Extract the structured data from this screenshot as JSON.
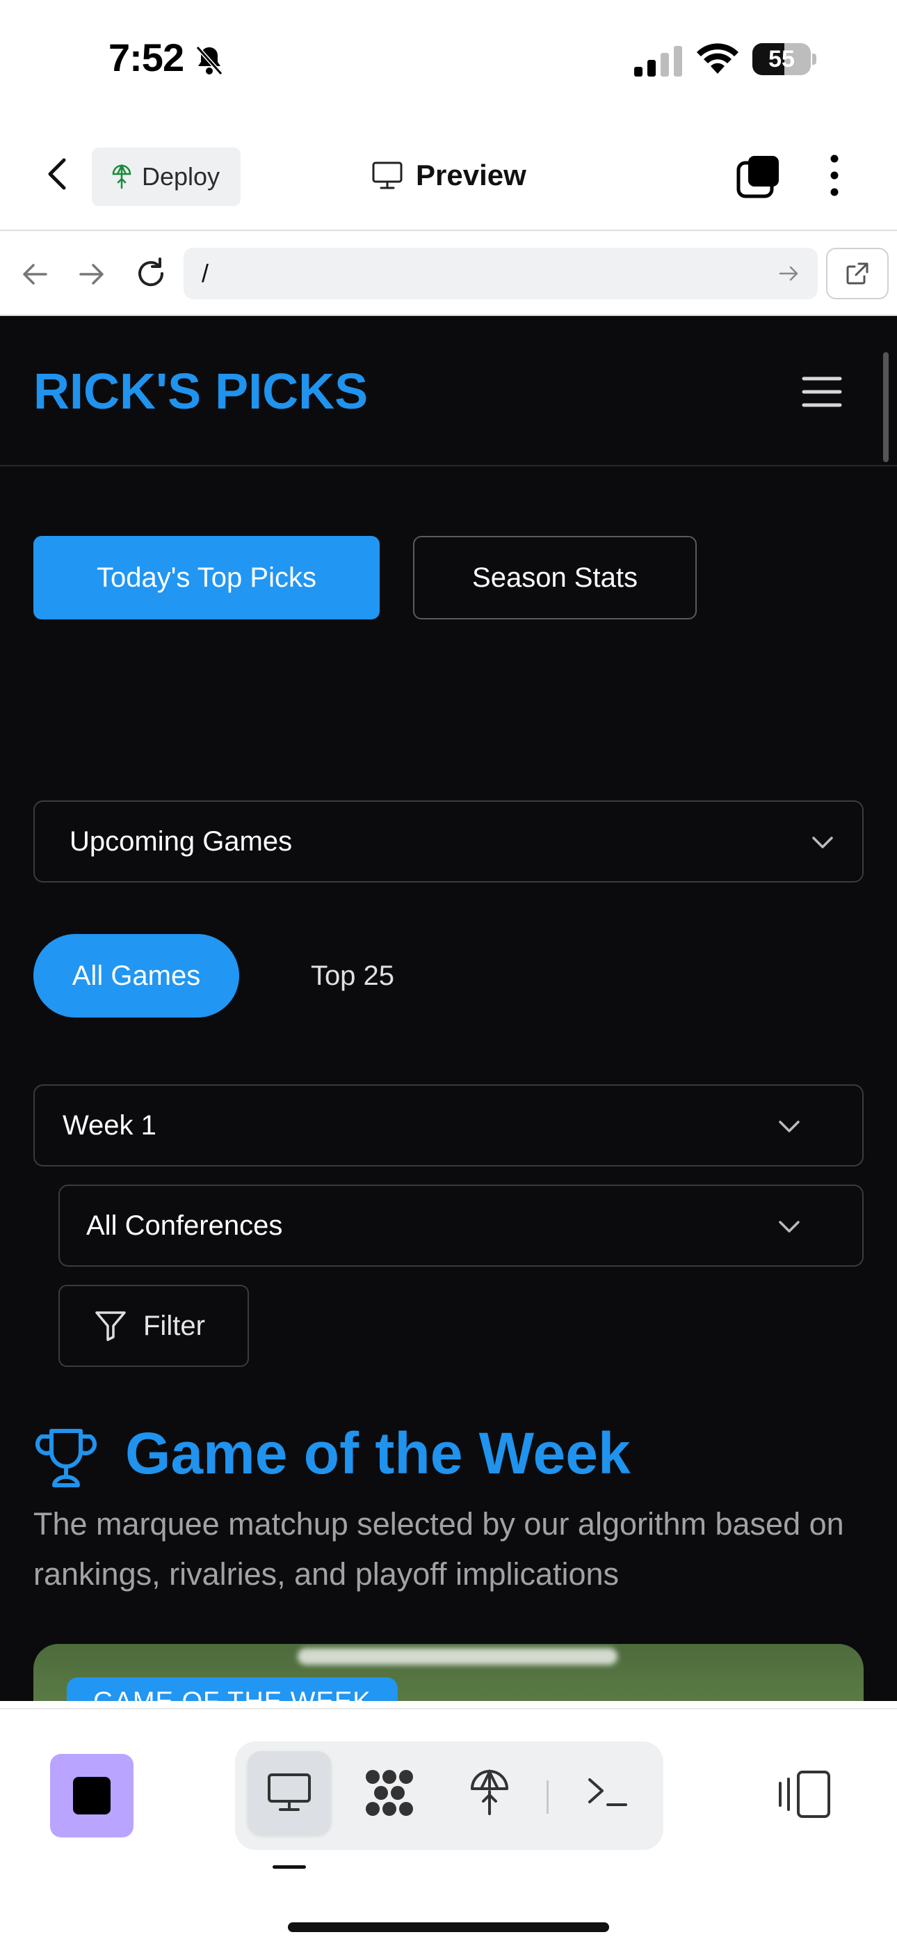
{
  "status_bar": {
    "time": "7:52",
    "battery_level": "55",
    "battery_fraction": 0.55
  },
  "app_header": {
    "deploy_label": "Deploy",
    "title": "Preview"
  },
  "url_bar": {
    "value": "/"
  },
  "site": {
    "logo": "RICK'S PICKS",
    "buttons": {
      "top_picks": "Today's Top Picks",
      "season_stats": "Season Stats"
    },
    "games_select": "Upcoming Games",
    "pills": {
      "all_games": "All Games",
      "top25": "Top 25"
    },
    "week_select": "Week 1",
    "conference_select": "All Conferences",
    "filter_label": "Filter",
    "gotw": {
      "title": "Game of the Week",
      "subtitle": "The marquee matchup selected by our algorithm based on rankings, rivalries, and playoff implications",
      "badge": "GAME OF THE WEEK"
    }
  },
  "colors": {
    "accent": "#2196f3",
    "logo_blue": "#2093ee",
    "page_bg": "#0b0b0d",
    "stop_purple": "#b9a4ff"
  },
  "toolbar": {
    "icons": [
      "stop-icon",
      "monitor-icon",
      "workspace-icon",
      "deploy-icon",
      "terminal-icon",
      "devices-icon"
    ]
  }
}
